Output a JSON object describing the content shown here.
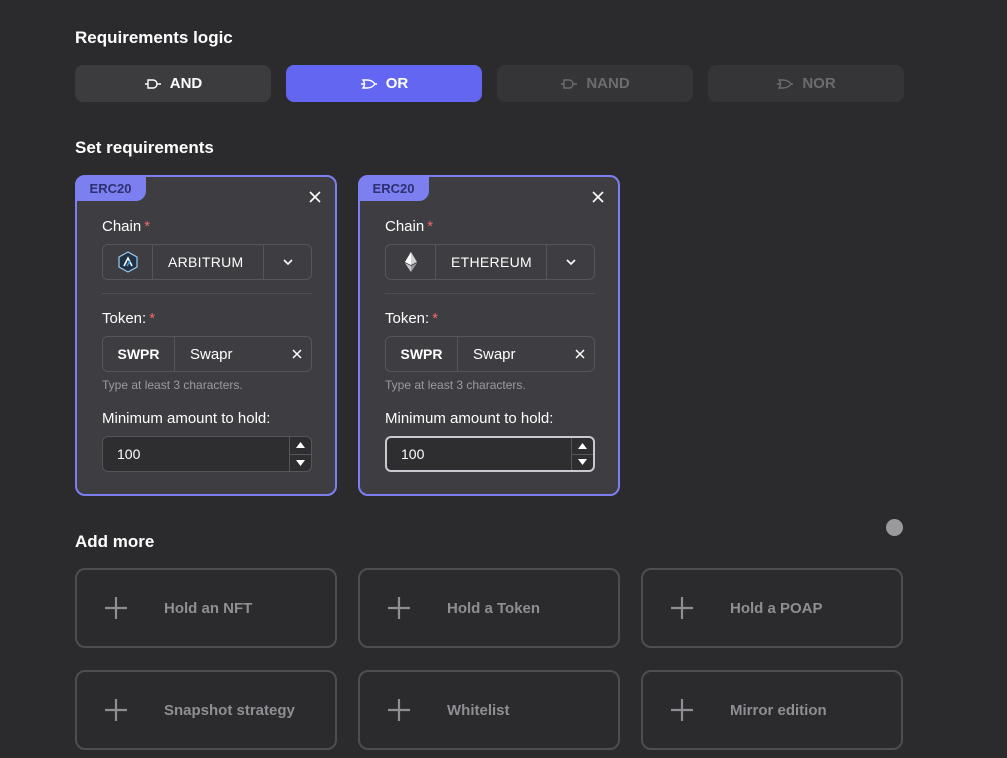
{
  "requirements_logic": {
    "title": "Requirements logic",
    "options": [
      {
        "label": "AND",
        "state": "default"
      },
      {
        "label": "OR",
        "state": "active"
      },
      {
        "label": "NAND",
        "state": "disabled"
      },
      {
        "label": "NOR",
        "state": "disabled"
      }
    ]
  },
  "set_requirements": {
    "title": "Set requirements",
    "cards": [
      {
        "badge": "ERC20",
        "chain_label": "Chain",
        "chain_value": "ARBITRUM",
        "token_label": "Token:",
        "token_symbol": "SWPR",
        "token_name": "Swapr",
        "hint": "Type at least 3 characters.",
        "amount_label": "Minimum amount to hold:",
        "amount_value": "100"
      },
      {
        "badge": "ERC20",
        "chain_label": "Chain",
        "chain_value": "ETHEREUM",
        "token_label": "Token:",
        "token_symbol": "SWPR",
        "token_name": "Swapr",
        "hint": "Type at least 3 characters.",
        "amount_label": "Minimum amount to hold:",
        "amount_value": "100"
      }
    ],
    "required_mark": "*"
  },
  "add_more": {
    "title": "Add more",
    "items": [
      {
        "label": "Hold an NFT"
      },
      {
        "label": "Hold a Token"
      },
      {
        "label": "Hold a POAP"
      },
      {
        "label": "Snapshot strategy"
      },
      {
        "label": "Whitelist"
      },
      {
        "label": "Mirror edition"
      }
    ]
  },
  "colors": {
    "background": "#2b2b2d",
    "accent": "#6366f1",
    "card_border": "#7b7ff0",
    "required": "#f06a6a"
  }
}
